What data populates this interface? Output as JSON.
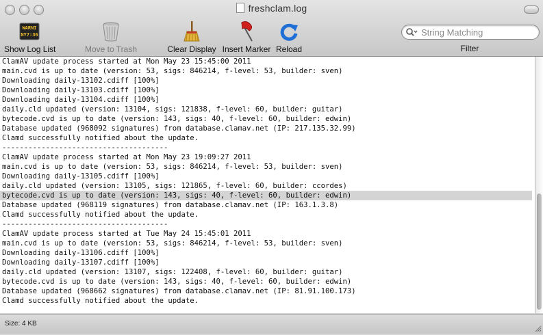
{
  "window": {
    "title": "freshclam.log"
  },
  "toolbar": {
    "show_log_list": "Show Log List",
    "move_to_trash": "Move to Trash",
    "clear_display": "Clear Display",
    "insert_marker": "Insert Marker",
    "reload": "Reload",
    "console_badge": "WARNI\nNY7:36",
    "filter_label": "Filter",
    "search_placeholder": "String Matching"
  },
  "log": {
    "lines": [
      "ClamAV update process started at Mon May 23 15:45:00 2011",
      "main.cvd is up to date (version: 53, sigs: 846214, f-level: 53, builder: sven)",
      "Downloading daily-13102.cdiff [100%]",
      "Downloading daily-13103.cdiff [100%]",
      "Downloading daily-13104.cdiff [100%]",
      "daily.cld updated (version: 13104, sigs: 121838, f-level: 60, builder: guitar)",
      "bytecode.cvd is up to date (version: 143, sigs: 40, f-level: 60, builder: edwin)",
      "Database updated (968092 signatures) from database.clamav.net (IP: 217.135.32.99)",
      "Clamd successfully notified about the update.",
      "--------------------------------------",
      "ClamAV update process started at Mon May 23 19:09:27 2011",
      "main.cvd is up to date (version: 53, sigs: 846214, f-level: 53, builder: sven)",
      "Downloading daily-13105.cdiff [100%]",
      "daily.cld updated (version: 13105, sigs: 121865, f-level: 60, builder: ccordes)",
      "bytecode.cvd is up to date (version: 143, sigs: 40, f-level: 60, builder: edwin)",
      "Database updated (968119 signatures) from database.clamav.net (IP: 163.1.3.8)",
      "Clamd successfully notified about the update.",
      "--------------------------------------",
      "ClamAV update process started at Tue May 24 15:45:01 2011",
      "main.cvd is up to date (version: 53, sigs: 846214, f-level: 53, builder: sven)",
      "Downloading daily-13106.cdiff [100%]",
      "Downloading daily-13107.cdiff [100%]",
      "daily.cld updated (version: 13107, sigs: 122408, f-level: 60, builder: guitar)",
      "bytecode.cvd is up to date (version: 143, sigs: 40, f-level: 60, builder: edwin)",
      "Database updated (968662 signatures) from database.clamav.net (IP: 81.91.100.173)",
      "Clamd successfully notified about the update."
    ],
    "highlighted_line": 14
  },
  "status": {
    "size": "Size: 4 KB"
  },
  "colors": {
    "highlight": "#d4d4d4",
    "reload_blue": "#1f6fd6",
    "marker_red": "#d0201e"
  }
}
